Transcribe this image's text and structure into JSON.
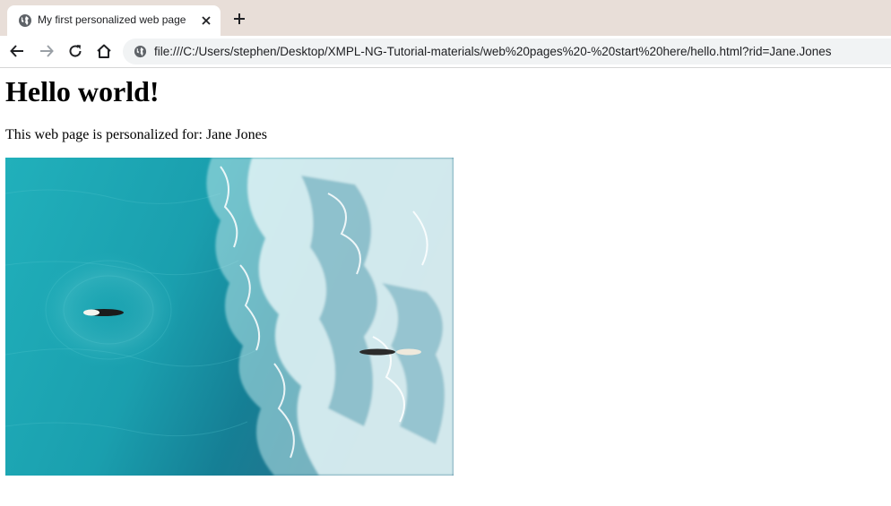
{
  "browser": {
    "tab_title": "My first personalized web page",
    "url": "file:///C:/Users/stephen/Desktop/XMPL-NG-Tutorial-materials/web%20pages%20-%20start%20here/hello.html?rid=Jane.Jones"
  },
  "page": {
    "heading": "Hello world!",
    "intro_label": "This web page is personalized for:",
    "person_name": "Jane Jones"
  },
  "icons": {
    "tab": [
      "globe-icon",
      "close-icon"
    ],
    "toolbar": [
      "back-arrow-icon",
      "forward-arrow-icon",
      "reload-icon",
      "home-icon",
      "globe-icon",
      "plus-icon"
    ]
  },
  "colors": {
    "tabstrip": "#e8ded8",
    "omnibox": "#f1f3f4",
    "ocean": "#1aa5b1"
  }
}
